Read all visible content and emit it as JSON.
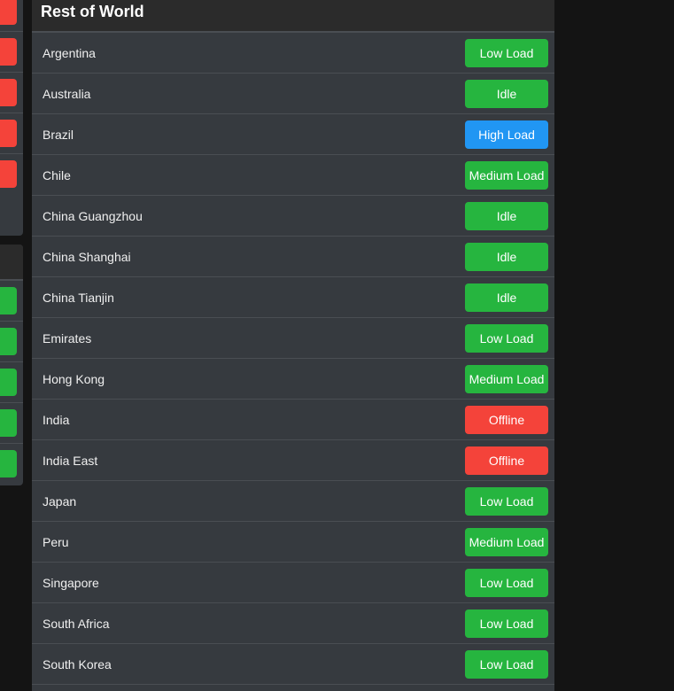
{
  "colors": {
    "green": "#26b53f",
    "blue": "#2196f3",
    "red": "#f4433a"
  },
  "left_column": {
    "top_status_colors": [
      "#f4433a",
      "#f4433a",
      "#f4433a",
      "#f4433a",
      "#f4433a"
    ],
    "bottom_status_colors": [
      "#26b53f",
      "#26b53f",
      "#26b53f",
      "#26b53f",
      "#26b53f"
    ]
  },
  "panel": {
    "title": "Rest of World",
    "rows": [
      {
        "name": "Argentina",
        "status": "Low Load",
        "color": "#26b53f"
      },
      {
        "name": "Australia",
        "status": "Idle",
        "color": "#26b53f"
      },
      {
        "name": "Brazil",
        "status": "High Load",
        "color": "#2196f3"
      },
      {
        "name": "Chile",
        "status": "Medium Load",
        "color": "#26b53f"
      },
      {
        "name": "China Guangzhou",
        "status": "Idle",
        "color": "#26b53f"
      },
      {
        "name": "China Shanghai",
        "status": "Idle",
        "color": "#26b53f"
      },
      {
        "name": "China Tianjin",
        "status": "Idle",
        "color": "#26b53f"
      },
      {
        "name": "Emirates",
        "status": "Low Load",
        "color": "#26b53f"
      },
      {
        "name": "Hong Kong",
        "status": "Medium Load",
        "color": "#26b53f"
      },
      {
        "name": "India",
        "status": "Offline",
        "color": "#f4433a"
      },
      {
        "name": "India East",
        "status": "Offline",
        "color": "#f4433a"
      },
      {
        "name": "Japan",
        "status": "Low Load",
        "color": "#26b53f"
      },
      {
        "name": "Peru",
        "status": "Medium Load",
        "color": "#26b53f"
      },
      {
        "name": "Singapore",
        "status": "Low Load",
        "color": "#26b53f"
      },
      {
        "name": "South Africa",
        "status": "Low Load",
        "color": "#26b53f"
      },
      {
        "name": "South Korea",
        "status": "Low Load",
        "color": "#26b53f"
      }
    ]
  }
}
